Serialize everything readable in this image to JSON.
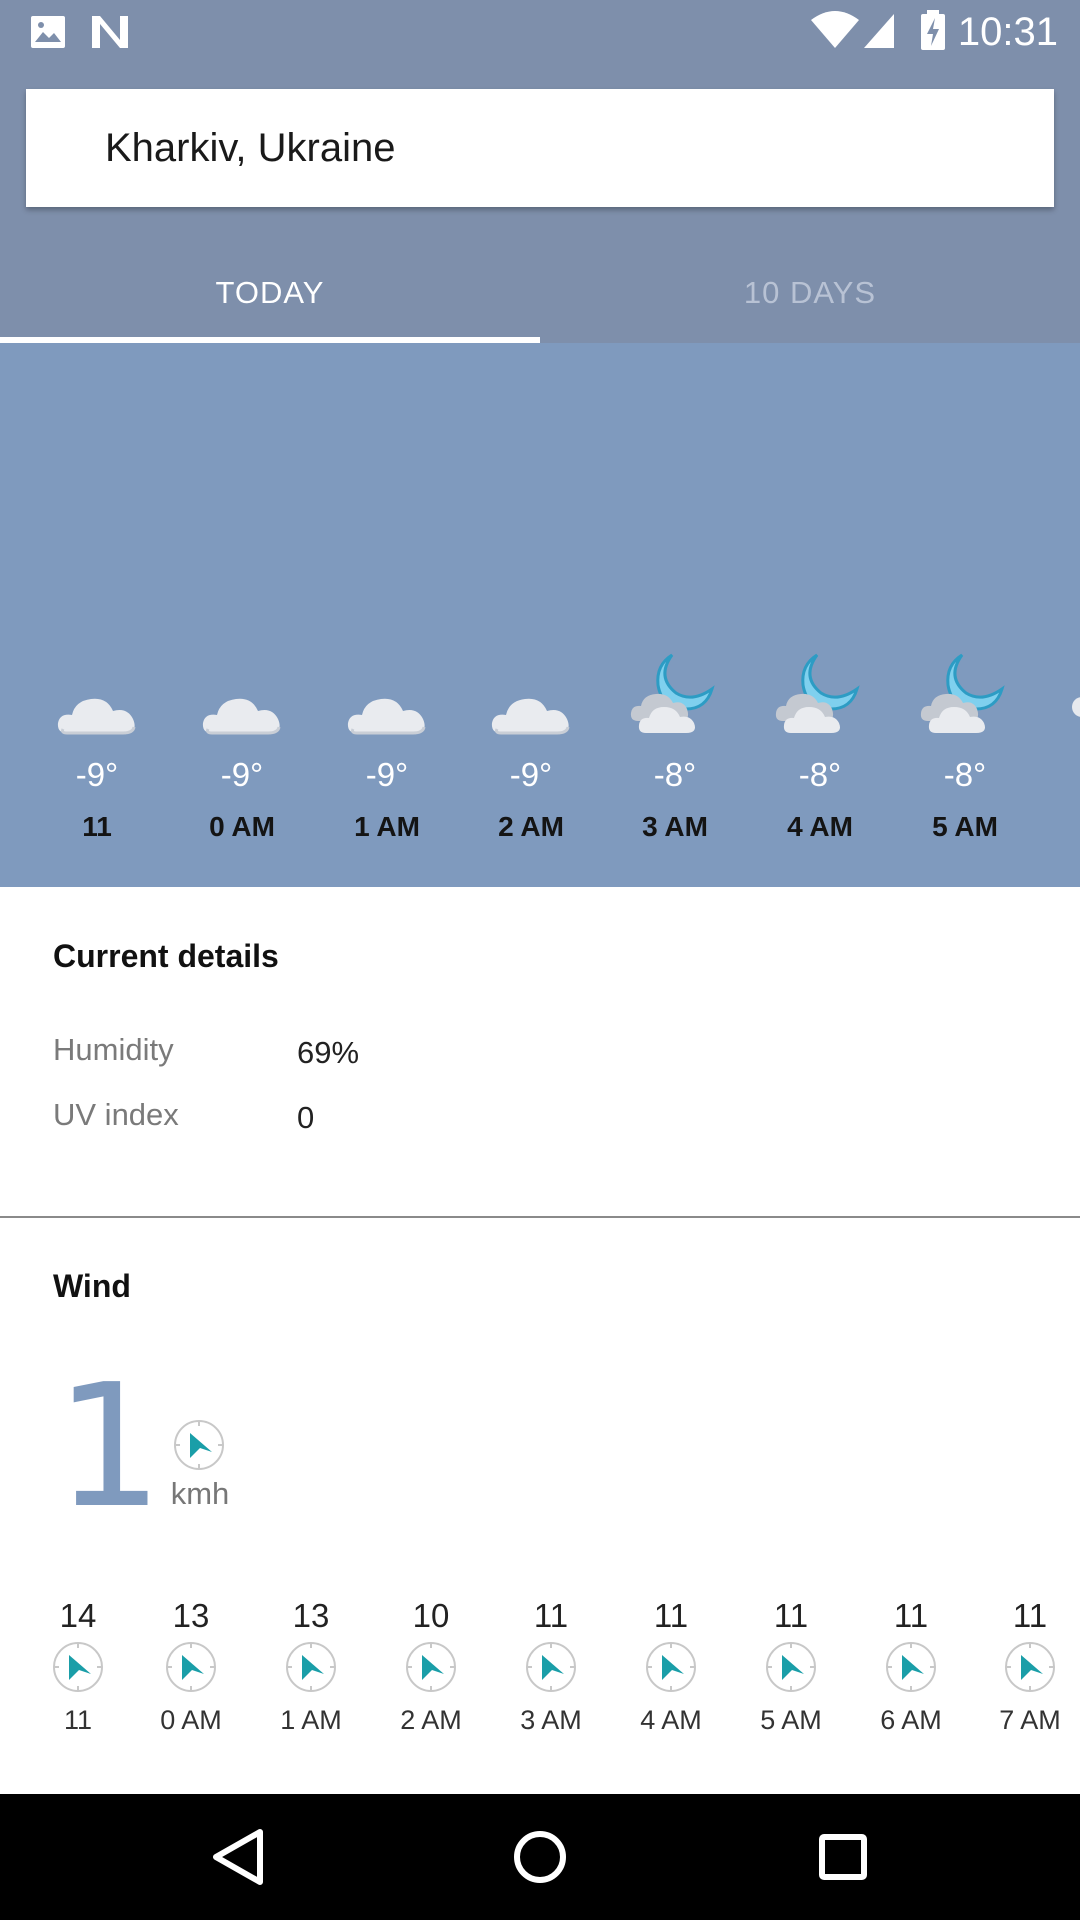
{
  "status_bar": {
    "time": "10:31",
    "left_icons": [
      "image-icon",
      "n-icon"
    ],
    "right_icons": [
      "wifi-icon",
      "signal-icon",
      "battery-charging-icon"
    ]
  },
  "search": {
    "location": "Kharkiv, Ukraine"
  },
  "tabs": [
    {
      "label": "TODAY",
      "selected": true
    },
    {
      "label": "10 DAYS",
      "selected": false
    }
  ],
  "hourly": [
    {
      "temp": "-9°",
      "label": "11",
      "icon": "cloud-icon"
    },
    {
      "temp": "-9°",
      "label": "0 AM",
      "icon": "cloud-icon"
    },
    {
      "temp": "-9°",
      "label": "1 AM",
      "icon": "cloud-icon"
    },
    {
      "temp": "-9°",
      "label": "2 AM",
      "icon": "cloud-icon"
    },
    {
      "temp": "-8°",
      "label": "3 AM",
      "icon": "moon-cloud-icon"
    },
    {
      "temp": "-8°",
      "label": "4 AM",
      "icon": "moon-cloud-icon"
    },
    {
      "temp": "-8°",
      "label": "5 AM",
      "icon": "moon-cloud-icon"
    }
  ],
  "current_details": {
    "title": "Current details",
    "rows": [
      {
        "label": "Humidity",
        "value": "69%"
      },
      {
        "label": "UV index",
        "value": "0"
      }
    ]
  },
  "wind": {
    "title": "Wind",
    "current_speed": "1",
    "unit": "kmh",
    "hourly": [
      {
        "speed": "14",
        "label": "11"
      },
      {
        "speed": "13",
        "label": "0 AM"
      },
      {
        "speed": "13",
        "label": "1 AM"
      },
      {
        "speed": "10",
        "label": "2 AM"
      },
      {
        "speed": "11",
        "label": "3 AM"
      },
      {
        "speed": "11",
        "label": "4 AM"
      },
      {
        "speed": "11",
        "label": "5 AM"
      },
      {
        "speed": "11",
        "label": "6 AM"
      },
      {
        "speed": "11",
        "label": "7 AM"
      }
    ]
  },
  "nav": [
    "back-icon",
    "home-icon",
    "recents-icon"
  ],
  "colors": {
    "header": "#7e8fab",
    "panel": "#7f9abe",
    "moon": "#7fd0ee",
    "compass_arrow": "#1a9ea8"
  }
}
